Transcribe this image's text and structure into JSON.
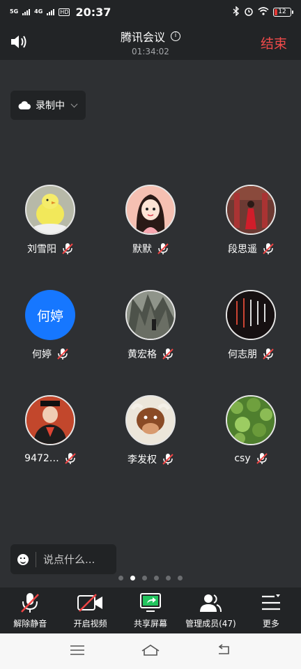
{
  "status_bar": {
    "signal1": "5G",
    "signal2": "4G",
    "hd": "HD",
    "time": "20:37",
    "battery": "12"
  },
  "header": {
    "title": "腾讯会议",
    "timer": "01:34:02",
    "end_label": "结束"
  },
  "recording": {
    "label": "录制中"
  },
  "participants": [
    {
      "name": "刘雪阳",
      "avatar": "chick-photo",
      "color": "#c6c9b8"
    },
    {
      "name": "默默",
      "avatar": "cartoon-girl",
      "color": "#f3b8a8"
    },
    {
      "name": "段思遥",
      "avatar": "red-dress-photo",
      "color": "#7a3b32"
    },
    {
      "name": "何婷",
      "avatar_text": "何婷",
      "color": "#1677ff"
    },
    {
      "name": "黄宏格",
      "avatar": "rocks-photo",
      "color": "#6c7066"
    },
    {
      "name": "何志朋",
      "avatar": "poem-image",
      "color": "#1b1415"
    },
    {
      "name": "9472…",
      "avatar": "graduate-photo",
      "color": "#b8462e"
    },
    {
      "name": "李发权",
      "avatar": "bull-cartoon",
      "color": "#e9e2d5"
    },
    {
      "name": "csy",
      "avatar": "leaves-photo",
      "color": "#5f8d3a"
    }
  ],
  "chat": {
    "placeholder": "说点什么..."
  },
  "pagination": {
    "total": 6,
    "active": 1
  },
  "toolbar": [
    {
      "label": "解除静音",
      "icon": "mic-muted-icon"
    },
    {
      "label": "开启视频",
      "icon": "camera-off-icon"
    },
    {
      "label": "共享屏幕",
      "icon": "share-screen-icon"
    },
    {
      "label": "管理成员(47)",
      "icon": "members-icon"
    },
    {
      "label": "更多",
      "icon": "more-menu-icon"
    }
  ]
}
